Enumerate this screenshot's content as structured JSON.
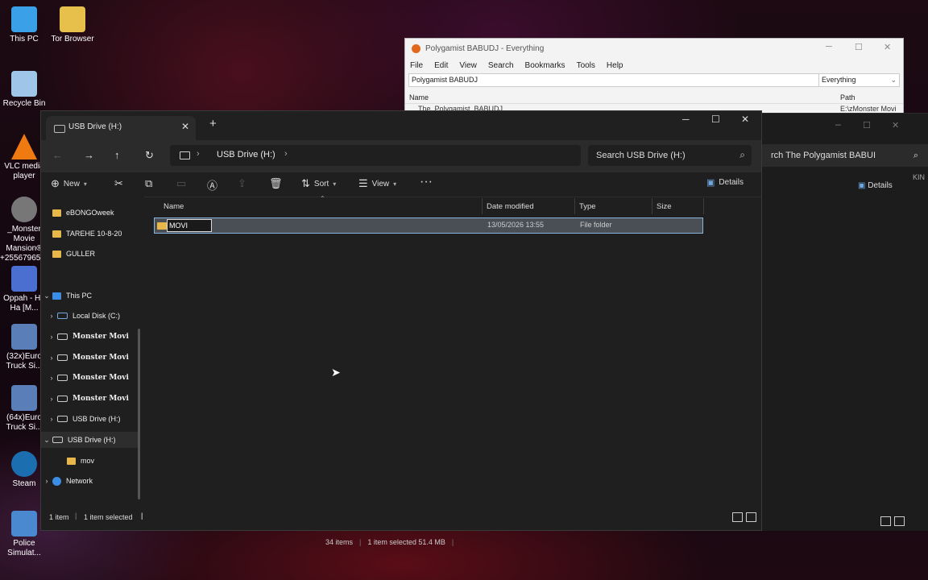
{
  "desktop": {
    "icons": [
      {
        "label": "This PC",
        "icon": "monitor-icon",
        "color": "#3aa0e8"
      },
      {
        "label": "Tor Browser",
        "icon": "tor-icon",
        "color": "#e6c04a"
      },
      {
        "label": "Recycle Bin",
        "icon": "recycle-bin-icon",
        "color": "#9fc6e8"
      },
      {
        "label": "VLC media player",
        "icon": "vlc-icon",
        "color": "#f07a12"
      },
      {
        "label": "_Monster Movie Mansion® +2556796599",
        "icon": "gear-icon",
        "color": "#777"
      },
      {
        "label": "Oppah - Ha Ha [M...",
        "icon": "media-file-icon",
        "color": "#4a6fd0"
      },
      {
        "label": "(32x)Euro Truck Si...",
        "icon": "truck-icon",
        "color": "#5a7fb8"
      },
      {
        "label": "(64x)Euro Truck Si...",
        "icon": "truck-icon",
        "color": "#5a7fb8"
      },
      {
        "label": "Steam",
        "icon": "steam-icon",
        "color": "#1b6fb0"
      },
      {
        "label": "Police Simulat...",
        "icon": "police-icon",
        "color": "#4a88d0"
      }
    ]
  },
  "everything": {
    "title": "Polygamist BABUDJ - Everything",
    "menu": [
      "File",
      "Edit",
      "View",
      "Search",
      "Bookmarks",
      "Tools",
      "Help"
    ],
    "search_value": "Polygamist BABUDJ",
    "filter": "Everything",
    "col_name": "Name",
    "col_path": "Path",
    "row_name": "The_Polygamist_BABUDJ",
    "row_path": "E:\\zMonster Movi"
  },
  "bg_explorer": {
    "search_text": "rch The  Polygamist  BABUI",
    "details": "Details",
    "side_text": "KIN",
    "status_items": "34 items",
    "status_selected": "1 item selected  51.4 MB"
  },
  "explorer": {
    "tab_title": "USB Drive (H:)",
    "breadcrumb": "USB Drive (H:)",
    "search_placeholder": "Search USB Drive (H:)",
    "toolbar": {
      "new": "New",
      "sort": "Sort",
      "view": "View",
      "details": "Details"
    },
    "columns": {
      "name": "Name",
      "date": "Date modified",
      "type": "Type",
      "size": "Size"
    },
    "nav_items": [
      {
        "label": "eBONGOweek",
        "kind": "folder"
      },
      {
        "label": "TAREHE 10-8-20",
        "kind": "folder"
      },
      {
        "label": "GULLER",
        "kind": "folder"
      },
      {
        "label": "This PC",
        "kind": "pc"
      },
      {
        "label": "Local Disk (C:)",
        "kind": "disk"
      },
      {
        "label": "Monster Movi",
        "kind": "drive"
      },
      {
        "label": "Monster Movi",
        "kind": "drive"
      },
      {
        "label": "Monster Movi",
        "kind": "drive"
      },
      {
        "label": "Monster Movi",
        "kind": "drive"
      },
      {
        "label": "USB Drive (H:)",
        "kind": "drive"
      },
      {
        "label": "USB Drive (H:)",
        "kind": "drive"
      },
      {
        "label": "mov",
        "kind": "folder"
      },
      {
        "label": "Network",
        "kind": "network"
      }
    ],
    "files": [
      {
        "name": "MOVI",
        "date": "13/05/2026 13:55",
        "type": "File folder",
        "size": ""
      }
    ],
    "status_count": "1 item",
    "status_selected": "1 item selected"
  }
}
